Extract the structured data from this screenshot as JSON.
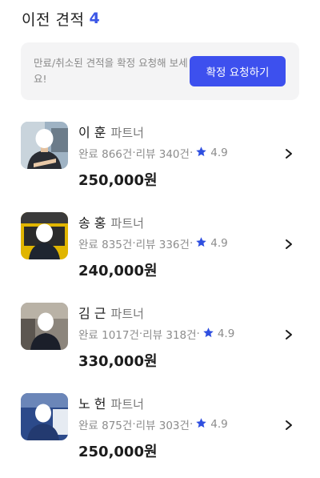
{
  "header": {
    "title": "이전 견적",
    "count": "4"
  },
  "notice": {
    "text": "만료/취소된 견적을 확정 요청해 보세요!",
    "button_label": "확정 요청하기"
  },
  "partners": [
    {
      "name": "이 훈",
      "role": "파트너",
      "completed": "완료 866건",
      "reviews": "리뷰 340건",
      "rating": "4.9",
      "price": "250,000원"
    },
    {
      "name": "송 홍",
      "role": "파트너",
      "completed": "완료 835건",
      "reviews": "리뷰 336건",
      "rating": "4.9",
      "price": "240,000원"
    },
    {
      "name": "김 근",
      "role": "파트너",
      "completed": "완료 1017건",
      "reviews": "리뷰 318건",
      "rating": "4.9",
      "price": "330,000원"
    },
    {
      "name": "노 헌",
      "role": "파트너",
      "completed": "완료 875건",
      "reviews": "리뷰 303건",
      "rating": "4.9",
      "price": "250,000원"
    }
  ],
  "colors": {
    "accent": "#3b56e6",
    "button": "#3d50ee",
    "star": "#2f4fe0"
  },
  "icons": {
    "rating": "star-icon",
    "row_action": "chevron-right-icon"
  }
}
